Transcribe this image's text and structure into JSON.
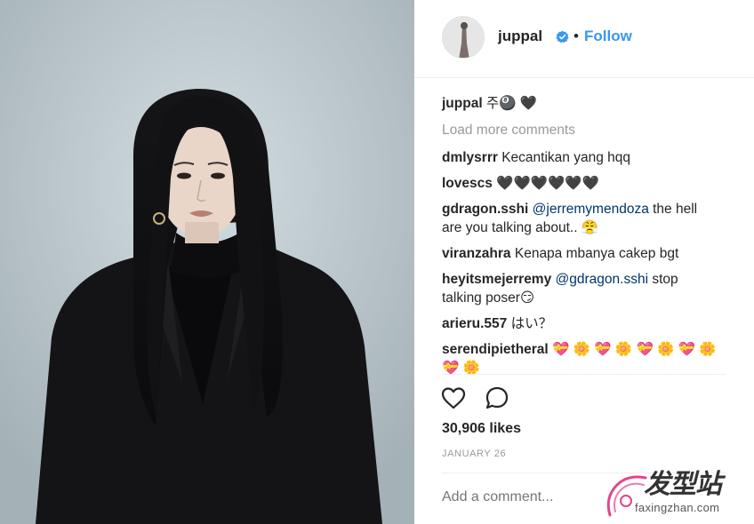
{
  "post": {
    "username": "juppal",
    "follow_label": "Follow",
    "separator": "•",
    "caption_user": "juppal",
    "caption_text": "주🎱 🖤",
    "load_more": "Load more comments",
    "likes": "30,906 likes",
    "date": "JANUARY 26",
    "add_comment_placeholder": "Add a comment..."
  },
  "comments": [
    {
      "user": "dmlysrrr",
      "text": "Kecantikan yang hqq"
    },
    {
      "user": "lovescs",
      "text": "🖤🖤🖤🖤🖤🖤"
    },
    {
      "user": "gdragon.sshi",
      "mention": "@jerremymendoza",
      "text": " the hell",
      "text2": "are you talking about.. 😤"
    },
    {
      "user": "viranzahra",
      "text": "Kenapa mbanya cakep bgt"
    },
    {
      "user": "heyitsmejerremy",
      "mention": "@gdragon.sshi",
      "text": " stop",
      "text2": "talking poser😏"
    },
    {
      "user": "arieru.557",
      "text": "はい？"
    },
    {
      "user": "serendipietheral",
      "text": "💝 🌼 💝 🌼 💝 🌼 💝 🌼",
      "text2": "💝 🌼"
    }
  ],
  "icons": {
    "like": "heart-icon",
    "comment": "comment-bubble-icon",
    "verified": "verified-badge-icon"
  },
  "colors": {
    "link": "#3897f0",
    "mention": "#003569",
    "muted": "#999999",
    "text": "#262626"
  },
  "watermark": {
    "brand": "发型站",
    "url": "faxingzhan.com"
  }
}
